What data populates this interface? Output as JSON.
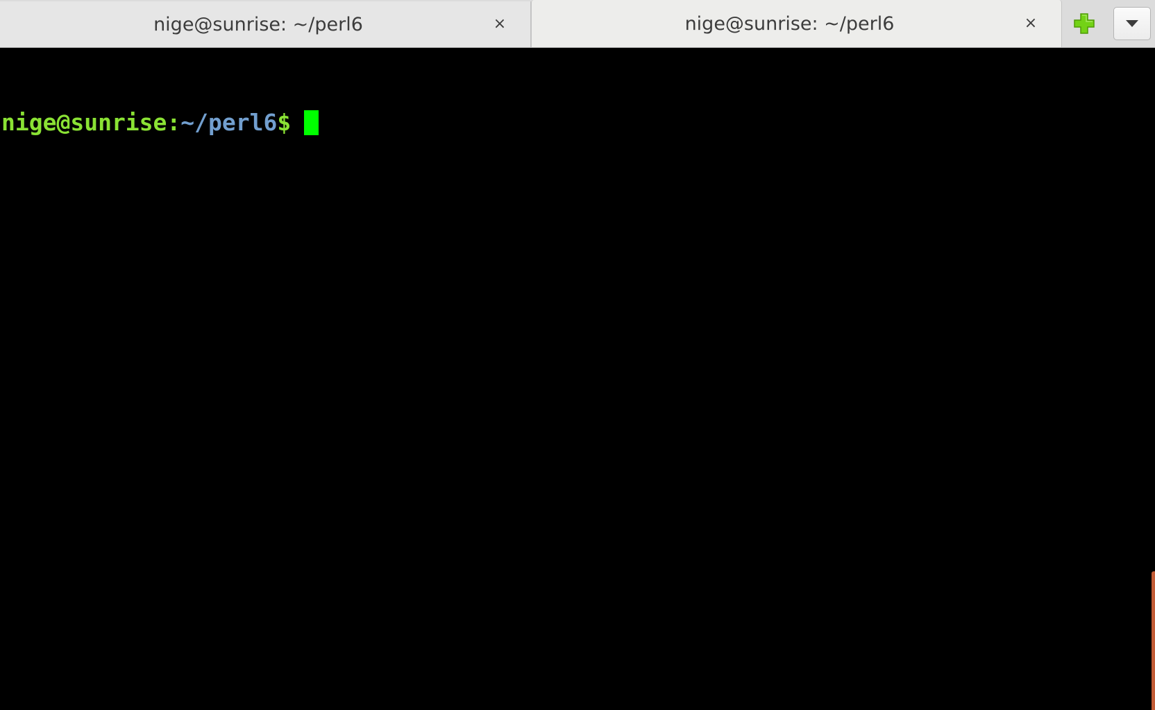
{
  "tabs": [
    {
      "label": "nige@sunrise: ~/perl6",
      "close_symbol": "×",
      "active": false
    },
    {
      "label": "nige@sunrise: ~/perl6",
      "close_symbol": "×",
      "active": true
    }
  ],
  "toolbar": {
    "new_tab_icon": "plus-icon",
    "menu_icon": "chevron-down-icon"
  },
  "terminal": {
    "prompt_user_host": "nige@sunrise",
    "prompt_separator": ":",
    "prompt_path": "~/perl6",
    "prompt_symbol": "$",
    "input_text": ""
  },
  "colors": {
    "prompt_user_host": "#8ae234",
    "prompt_separator": "#8ae234",
    "prompt_path": "#729fcf",
    "prompt_symbol": "#8ae234",
    "cursor": "#00ff00",
    "new_tab_icon": "#73d216",
    "scrollbar_thumb": "#c25c36"
  }
}
